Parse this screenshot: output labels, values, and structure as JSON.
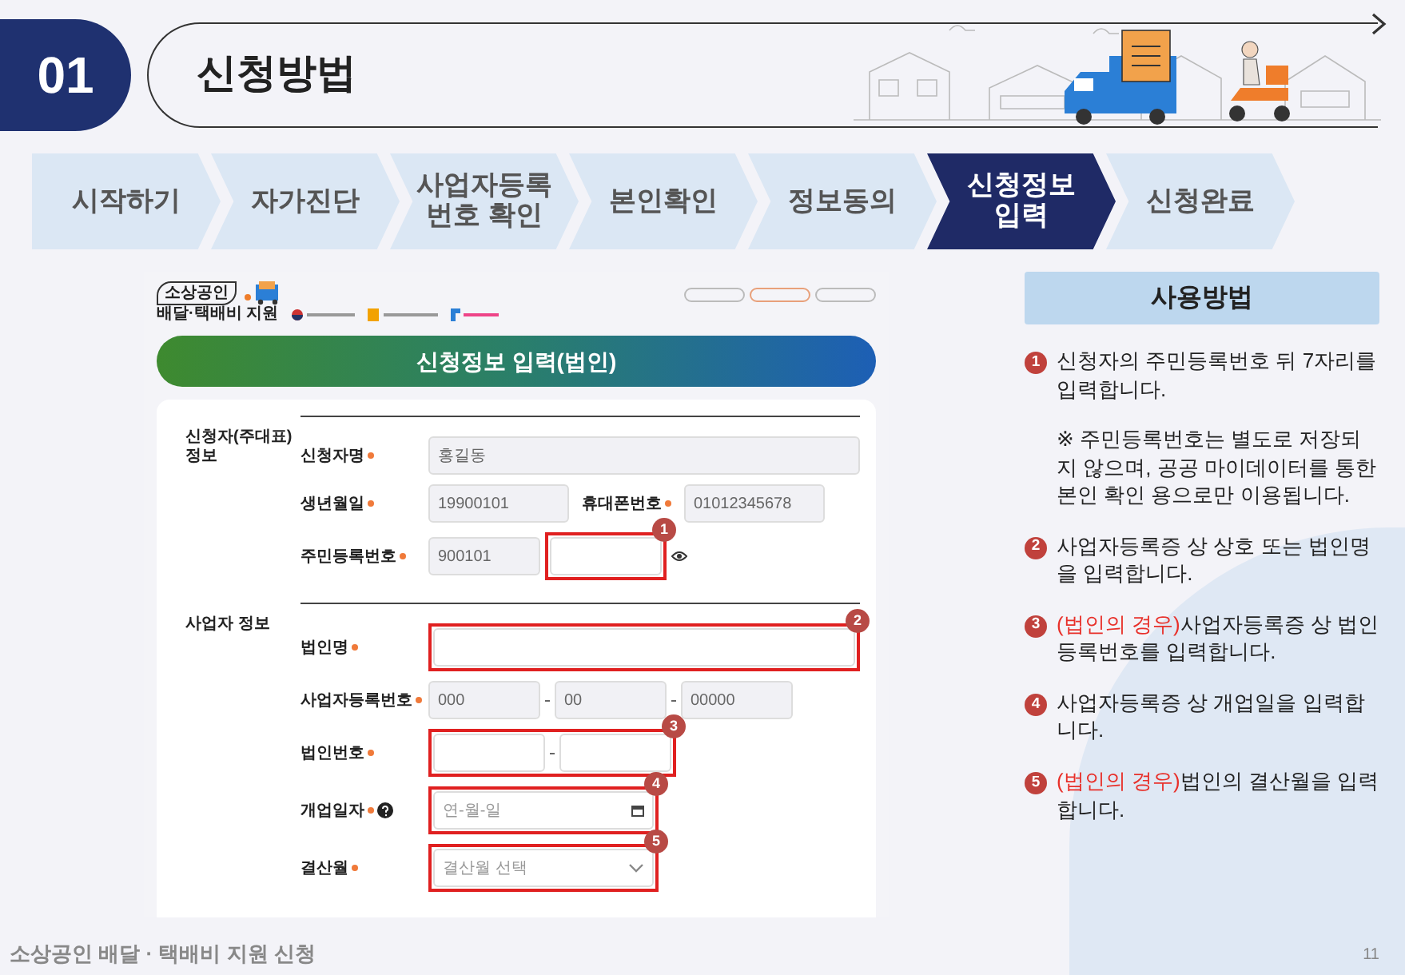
{
  "section": {
    "number": "01",
    "title": "신청방법"
  },
  "steps": [
    {
      "lines": [
        "시작하기"
      ],
      "selected": false
    },
    {
      "lines": [
        "자가진단"
      ],
      "selected": false
    },
    {
      "lines": [
        "사업자등록",
        "번호 확인"
      ],
      "selected": false
    },
    {
      "lines": [
        "본인확인"
      ],
      "selected": false
    },
    {
      "lines": [
        "정보동의"
      ],
      "selected": false
    },
    {
      "lines": [
        "신청정보",
        "입력"
      ],
      "selected": true
    },
    {
      "lines": [
        "신청완료"
      ],
      "selected": false
    }
  ],
  "screenshot": {
    "logo": {
      "badge": "소상공인",
      "subtitle": "배달·택배비 지원"
    },
    "banner": "신청정보 입력(법인)",
    "sections": [
      {
        "title": "신청자(주대표) 정보",
        "rows": [
          {
            "items": [
              {
                "label": "신청자명",
                "required": true,
                "inputs": [
                  {
                    "kind": "text",
                    "value": "홍길동",
                    "readonly": true
                  }
                ]
              }
            ]
          },
          {
            "items": [
              {
                "label": "생년월일",
                "required": true,
                "inputs": [
                  {
                    "kind": "text",
                    "value": "19900101",
                    "readonly": true
                  }
                ]
              },
              {
                "label": "휴대폰번호",
                "required": true,
                "inputs": [
                  {
                    "kind": "text",
                    "value": "01012345678",
                    "readonly": true
                  }
                ]
              }
            ]
          },
          {
            "items": [
              {
                "label": "주민등록번호",
                "required": true,
                "show_toggle": true,
                "inputs": [
                  {
                    "kind": "text",
                    "value": "900101",
                    "readonly": true
                  },
                  {
                    "kind": "text",
                    "readonly": false,
                    "callout": "1"
                  }
                ]
              }
            ]
          }
        ]
      },
      {
        "title": "사업자 정보",
        "rows": [
          {
            "items": [
              {
                "label": "법인명",
                "required": true,
                "callout": "2",
                "inputs": [
                  {
                    "kind": "text",
                    "readonly": false
                  }
                ]
              }
            ]
          },
          {
            "items": [
              {
                "label": "사업자등록번호",
                "required": true,
                "joined": true,
                "inputs": [
                  {
                    "kind": "text",
                    "value": "000",
                    "readonly": true
                  },
                  {
                    "kind": "text",
                    "value": "00",
                    "readonly": true
                  },
                  {
                    "kind": "text",
                    "value": "00000",
                    "readonly": true
                  }
                ]
              }
            ]
          },
          {
            "items": [
              {
                "label": "법인번호",
                "required": true,
                "joined": true,
                "callout": "3",
                "inputs": [
                  {
                    "kind": "text",
                    "readonly": false
                  },
                  {
                    "kind": "text",
                    "readonly": false
                  }
                ]
              }
            ]
          },
          {
            "items": [
              {
                "label": "개업일자",
                "required": true,
                "help": true,
                "callout": "4",
                "inputs": [
                  {
                    "kind": "date",
                    "placeholder": "연-월-일",
                    "readonly": false
                  }
                ]
              }
            ]
          },
          {
            "items": [
              {
                "label": "결산월",
                "required": true,
                "callout": "5",
                "inputs": [
                  {
                    "kind": "select",
                    "placeholder": "결산월 선택",
                    "readonly": false
                  }
                ]
              }
            ]
          }
        ]
      }
    ]
  },
  "guide": {
    "title": "사용방법",
    "items": [
      {
        "number": "1",
        "text": "신청자의 주민등록번호 뒤 7자리를 입력합니다.",
        "note": "※ 주민등록번호는 별도로 저장되지 않으며, 공공 마이데이터를 통한 본인 확인 용으로만 이용됩니다."
      },
      {
        "number": "2",
        "text": "사업자등록증 상 상호 또는 법인명을 입력합니다."
      },
      {
        "number": "3",
        "prefix": "(법인의 경우)",
        "text": "사업자등록증 상 법인등록번호를 입력합니다."
      },
      {
        "number": "4",
        "text": "사업자등록증 상 개업일을 입력합니다."
      },
      {
        "number": "5",
        "prefix": "(법인의 경우)",
        "text": "법인의 결산월을 입력합니다."
      }
    ]
  },
  "footer": {
    "title": "소상공인 배달 · 택배비 지원 신청",
    "page": "11"
  }
}
